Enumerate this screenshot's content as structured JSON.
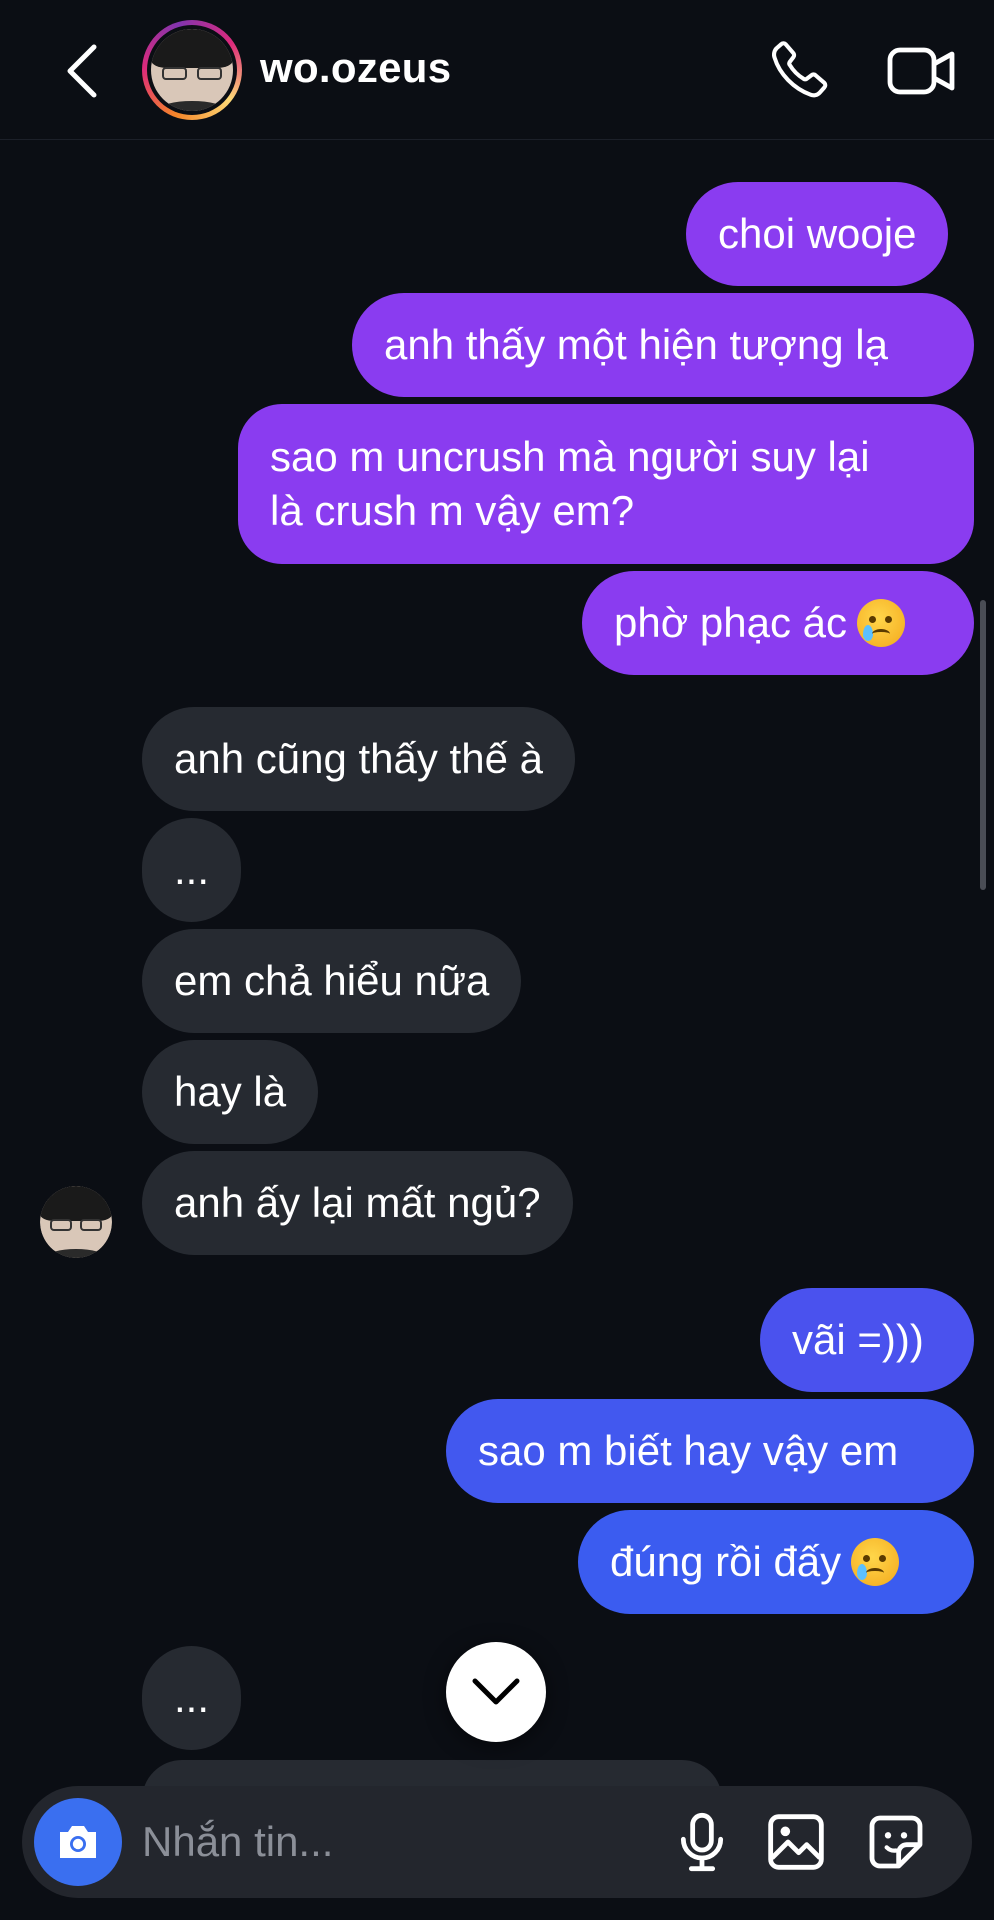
{
  "header": {
    "username": "wo.ozeus",
    "back_icon": "chevron-left-icon",
    "call_icon": "phone-icon",
    "video_icon": "video-camera-icon"
  },
  "colors": {
    "background": "#0b0e14",
    "sent_purple_top": "#8a3cf0",
    "sent_blue_bottom": "#3b5cf0",
    "received": "#262a31",
    "camera_button": "#3a6ff0"
  },
  "messages": [
    {
      "from": "me",
      "text": "choi wooje"
    },
    {
      "from": "me",
      "text": "anh thấy một hiện tượng lạ"
    },
    {
      "from": "me",
      "line1": "sao m uncrush mà người suy lại",
      "line2": "là crush m vậy em?"
    },
    {
      "from": "me",
      "text": "phờ phạc ác",
      "emoji": "crying-smile-emoji"
    },
    {
      "from": "them",
      "text": "anh cũng thấy thế à"
    },
    {
      "from": "them",
      "text": "..."
    },
    {
      "from": "them",
      "text": "em chả hiểu nữa"
    },
    {
      "from": "them",
      "text": "hay là"
    },
    {
      "from": "them",
      "text": "anh ấy lại mất ngủ?"
    },
    {
      "from": "me",
      "text": "vãi =)))"
    },
    {
      "from": "me",
      "text": "sao m biết hay vậy em"
    },
    {
      "from": "me",
      "text": "đúng rồi đấy",
      "emoji": "crying-smile-emoji"
    },
    {
      "from": "them",
      "text": "..."
    }
  ],
  "composer": {
    "placeholder": "Nhắn tin...",
    "camera_icon": "camera-icon",
    "mic_icon": "microphone-icon",
    "gallery_icon": "image-icon",
    "sticker_icon": "sticker-icon"
  }
}
